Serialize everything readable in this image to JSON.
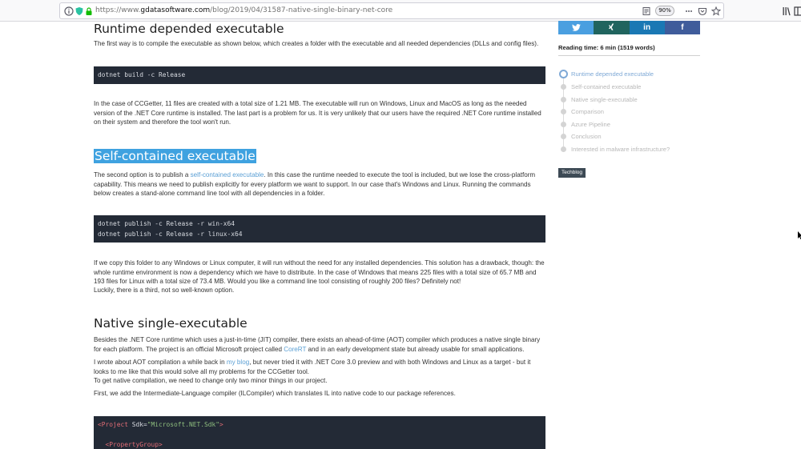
{
  "browser": {
    "url_prefix": "https://www.",
    "url_host": "gdatasoftware.com",
    "url_path": "/blog/2019/04/31587-native-single-binary-net-core",
    "zoom": "90%"
  },
  "article": {
    "sections": [
      {
        "heading": "Runtime depended executable",
        "p1": "The first way is to compile the executable as shown below, which creates a folder with the executable and all needed dependencies (DLLs and config files).",
        "code": "dotnet build -c Release",
        "p2": "In the case of CCGetter, 11 files are created with a total size of 1.21 MB. The executable will run on Windows, Linux and MacOS as long as the needed version of the .NET Core runtime is installed. The last part is a problem for us. It is very unlikely that our users have the required .NET Core runtime installed on their system and therefore the tool won't run."
      },
      {
        "heading": "Self-contained executable",
        "p1_a": "The second option is to publish a ",
        "p1_link": "self-contained executable",
        "p1_b": ". In this case the runtime needed to execute the tool is included, but we lose the cross-platform capability. This means we need to publish explicitly for every platform we want to support. In our case that's Windows and Linux. Running the commands below creates a stand-alone command line tool with all dependencies in a folder.",
        "code_l1": "dotnet publish -c Release -r win-x64",
        "code_l2": "dotnet publish -c Release -r linux-x64",
        "p2": "If we copy this folder to any Windows or Linux computer, it will run without the need for any installed dependencies. This solution has a drawback, though: the whole runtime environment is now a dependency which we have to distribute. In the case of Windows that means 225 files with a total size of 65.7 MB and 193 files for Linux with a total size of 73.4 MB. Would you like a command line tool consisting of roughly 200 files? Definitely not!",
        "p3": "Luckily, there is a third, not so well-known option."
      },
      {
        "heading": "Native single-executable",
        "p1_a": "Besides the .NET Core runtime which uses a just-in-time (JIT) compiler, there exists an ahead-of-time (AOT) compiler which produces a native single binary for each platform. The project is an official Microsoft project called ",
        "p1_link": "CoreRT",
        "p1_b": " and in an early development state but already usable for small applications.",
        "p2_a": "I wrote about AOT compilation a while back in ",
        "p2_link": "my blog",
        "p2_b": ", but never tried it with .NET Core 3.0 preview and with both Windows and Linux as a target - but it looks to me like that this would solve all my problems for the CCGetter tool.",
        "p2_c": "To get native compilation, we need to change only two minor things in our project.",
        "p3": "First, we add the Intermediate-Language compiler (ILCompiler) which translates IL into native code to our package references.",
        "code_tag1_open": "<Project",
        "code_attr1": " Sdk=",
        "code_str1": "\"Microsoft.NET.Sdk\"",
        "code_tag1_close": ">",
        "code_tag2": "<PropertyGroup>"
      }
    ]
  },
  "sidebar": {
    "share": [
      {
        "name": "twitter",
        "glyph": "🐦",
        "color": "#4a9fe0"
      },
      {
        "name": "xing",
        "glyph": "✗",
        "color": "#20645e"
      },
      {
        "name": "linkedin",
        "glyph": "in",
        "color": "#1a78b4"
      },
      {
        "name": "facebook",
        "glyph": "f",
        "color": "#3f5c9b"
      }
    ],
    "reading_time": "Reading time: 6 min (1519 words)",
    "toc": [
      "Runtime depended executable",
      "Self-contained executable",
      "Native single-executable",
      "Comparison",
      "Azure Pipeline",
      "Conclusion",
      "Interested in malware infrastructure?"
    ],
    "tag": "Techblog"
  }
}
